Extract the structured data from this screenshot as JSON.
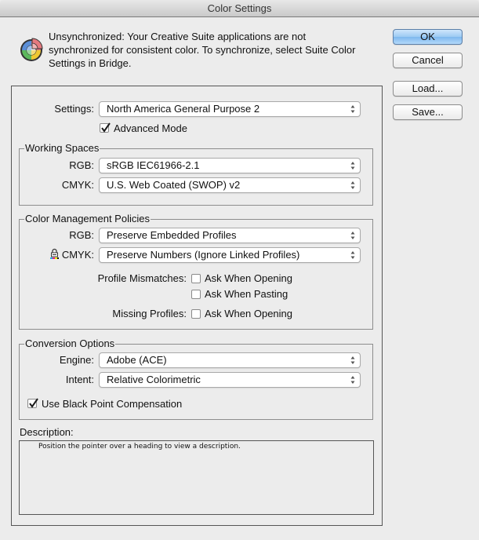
{
  "window": {
    "title": "Color Settings"
  },
  "warning": {
    "icon": "color-wheel-warning-icon",
    "text": "Unsynchronized: Your Creative Suite applications are not synchronized for consistent color. To synchronize, select Suite Color Settings in Bridge."
  },
  "buttons": {
    "ok": "OK",
    "cancel": "Cancel",
    "load": "Load...",
    "save": "Save..."
  },
  "settings": {
    "label": "Settings:",
    "value": "North America General Purpose 2",
    "advanced_mode": {
      "label": "Advanced Mode",
      "checked": true
    }
  },
  "working_spaces": {
    "title": "Working Spaces",
    "rgb": {
      "label": "RGB:",
      "value": "sRGB IEC61966-2.1"
    },
    "cmyk": {
      "label": "CMYK:",
      "value": "U.S. Web Coated (SWOP) v2"
    }
  },
  "policies": {
    "title": "Color Management Policies",
    "rgb": {
      "label": "RGB:",
      "value": "Preserve Embedded Profiles"
    },
    "cmyk": {
      "label": "CMYK:",
      "value": "Preserve Numbers (Ignore Linked Profiles)",
      "icon": "lock-icon"
    },
    "profile_mismatches": {
      "label": "Profile Mismatches:",
      "ask_opening": {
        "label": "Ask When Opening",
        "checked": false
      },
      "ask_pasting": {
        "label": "Ask When Pasting",
        "checked": false
      }
    },
    "missing_profiles": {
      "label": "Missing Profiles:",
      "ask_opening": {
        "label": "Ask When Opening",
        "checked": false
      }
    }
  },
  "conversion": {
    "title": "Conversion Options",
    "engine": {
      "label": "Engine:",
      "value": "Adobe (ACE)"
    },
    "intent": {
      "label": "Intent:",
      "value": "Relative Colorimetric"
    },
    "black_point": {
      "label": "Use Black Point Compensation",
      "checked": true
    }
  },
  "description": {
    "title": "Description:",
    "text": "Position the pointer over a heading to view a description."
  },
  "colors": {
    "default_button": "#9ccaf3",
    "panel_border": "#555555",
    "background": "#ececec"
  }
}
